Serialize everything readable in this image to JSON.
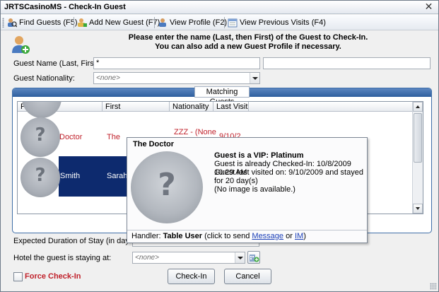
{
  "window": {
    "title": "JRTSCasinoMS - Check-In Guest",
    "close_glyph": "✕"
  },
  "toolbar": {
    "items": [
      {
        "label": "Find Guests (F5)",
        "icon": "find-guests-icon"
      },
      {
        "label": "Add New Guest (F7)",
        "icon": "add-guest-icon"
      },
      {
        "label": "View Profile (F2)",
        "icon": "view-profile-icon"
      },
      {
        "label": "View Previous Visits (F4)",
        "icon": "previous-visits-icon"
      }
    ]
  },
  "instructions": {
    "line1": "Please enter the name (Last, then First) of the Guest to Check-In.",
    "line2": "You can also add a new Guest Profile if necessary."
  },
  "form": {
    "guest_name_label": "Guest Name (Last, First):",
    "guest_last_value": "*",
    "guest_first_value": "",
    "nationality_label": "Guest Nationality:",
    "nationality_value": "<none>",
    "duration_label": "Expected Duration of Stay (in days):",
    "hotel_label": "Hotel the guest is staying at:",
    "hotel_value": "<none>",
    "force_checkin_label": "Force Check-In"
  },
  "matching": {
    "title": "Matching Guests",
    "columns": [
      "Primary",
      "First",
      "Nationality",
      "Last Visit"
    ],
    "rows": [
      {
        "last": "Doctor",
        "first": "The",
        "nationality": "ZZZ - (None",
        "last_visit": "9/10/2",
        "style": "red"
      },
      {
        "last": "Smith",
        "first": "Sarah",
        "nationality": "",
        "last_visit": "",
        "style": "selected"
      }
    ]
  },
  "popup": {
    "name": "The Doctor",
    "vip": "Guest is a VIP: Platinum",
    "checked_in": "Guest is already Checked-In: 10/8/2009 10:29 AM",
    "last_visit": "Guest last visited on: 9/10/2009 and stayed for 20 day(s)",
    "no_image": "(No image is available.)",
    "handler_label": "Handler:",
    "handler_name": "Table User",
    "handler_text": "(click to send",
    "message_link": "Message",
    "or_text": "or",
    "im_link": "IM",
    "close_paren": ")"
  },
  "buttons": {
    "checkin": "Check-In",
    "cancel": "Cancel"
  },
  "colors": {
    "accent_bar": "#2f5f9e",
    "selected_row": "#0d2a6e",
    "red_text": "#c0202a",
    "link": "#1b3fb7"
  }
}
